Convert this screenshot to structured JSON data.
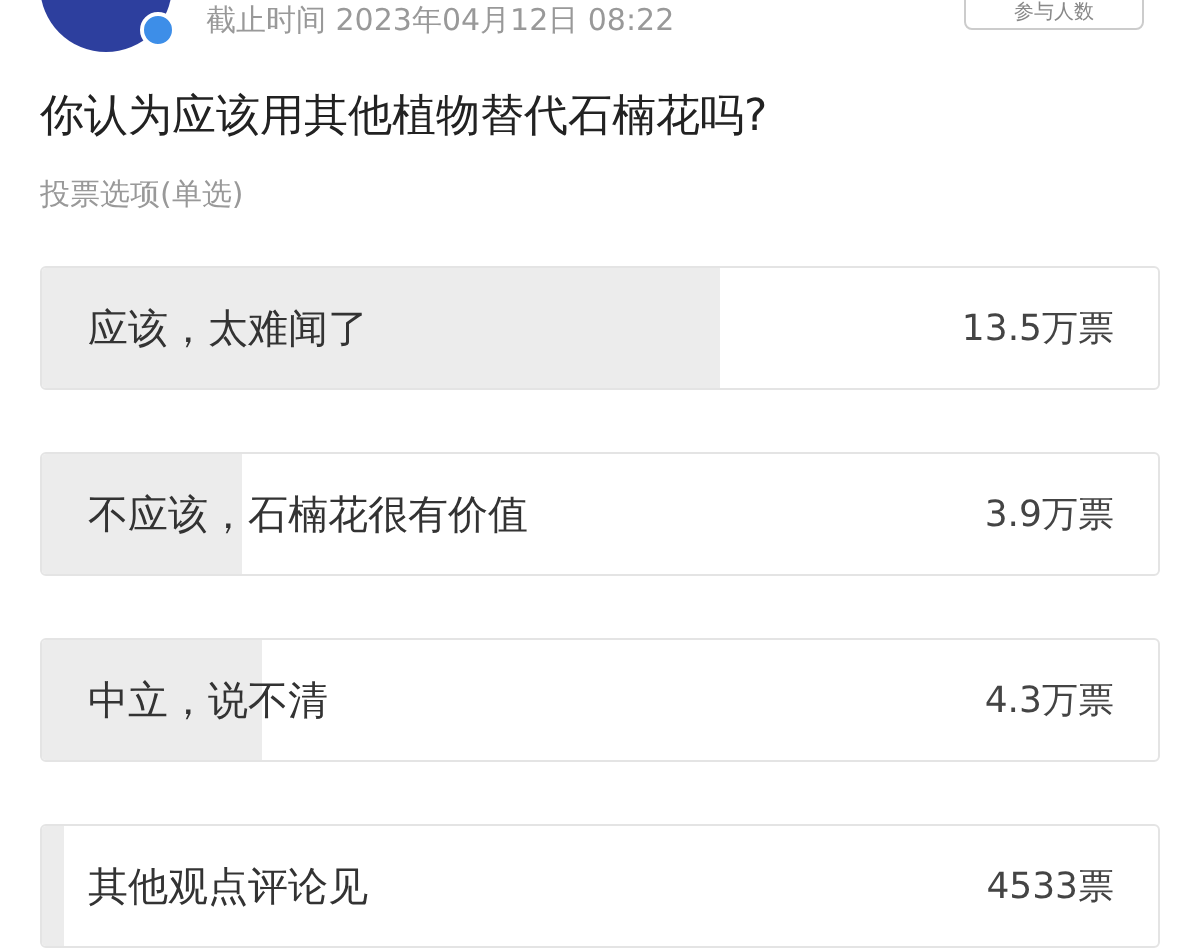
{
  "header": {
    "deadline": "截止时间 2023年04月12日 08:22",
    "button": "参与人数"
  },
  "question": "你认为应该用其他植物替代石楠花吗?",
  "options_label": "投票选项(单选)",
  "options": [
    {
      "label": "应该，太难闻了",
      "votes": "13.5万票",
      "level": 0.607
    },
    {
      "label": "不应该，石楠花很有价值",
      "votes": "3.9万票",
      "level": 0.18
    },
    {
      "label": "中立，说不清",
      "votes": "4.3万票",
      "level": 0.197
    },
    {
      "label": "其他观点评论见",
      "votes": "4533票",
      "level": 0.02
    }
  ]
}
